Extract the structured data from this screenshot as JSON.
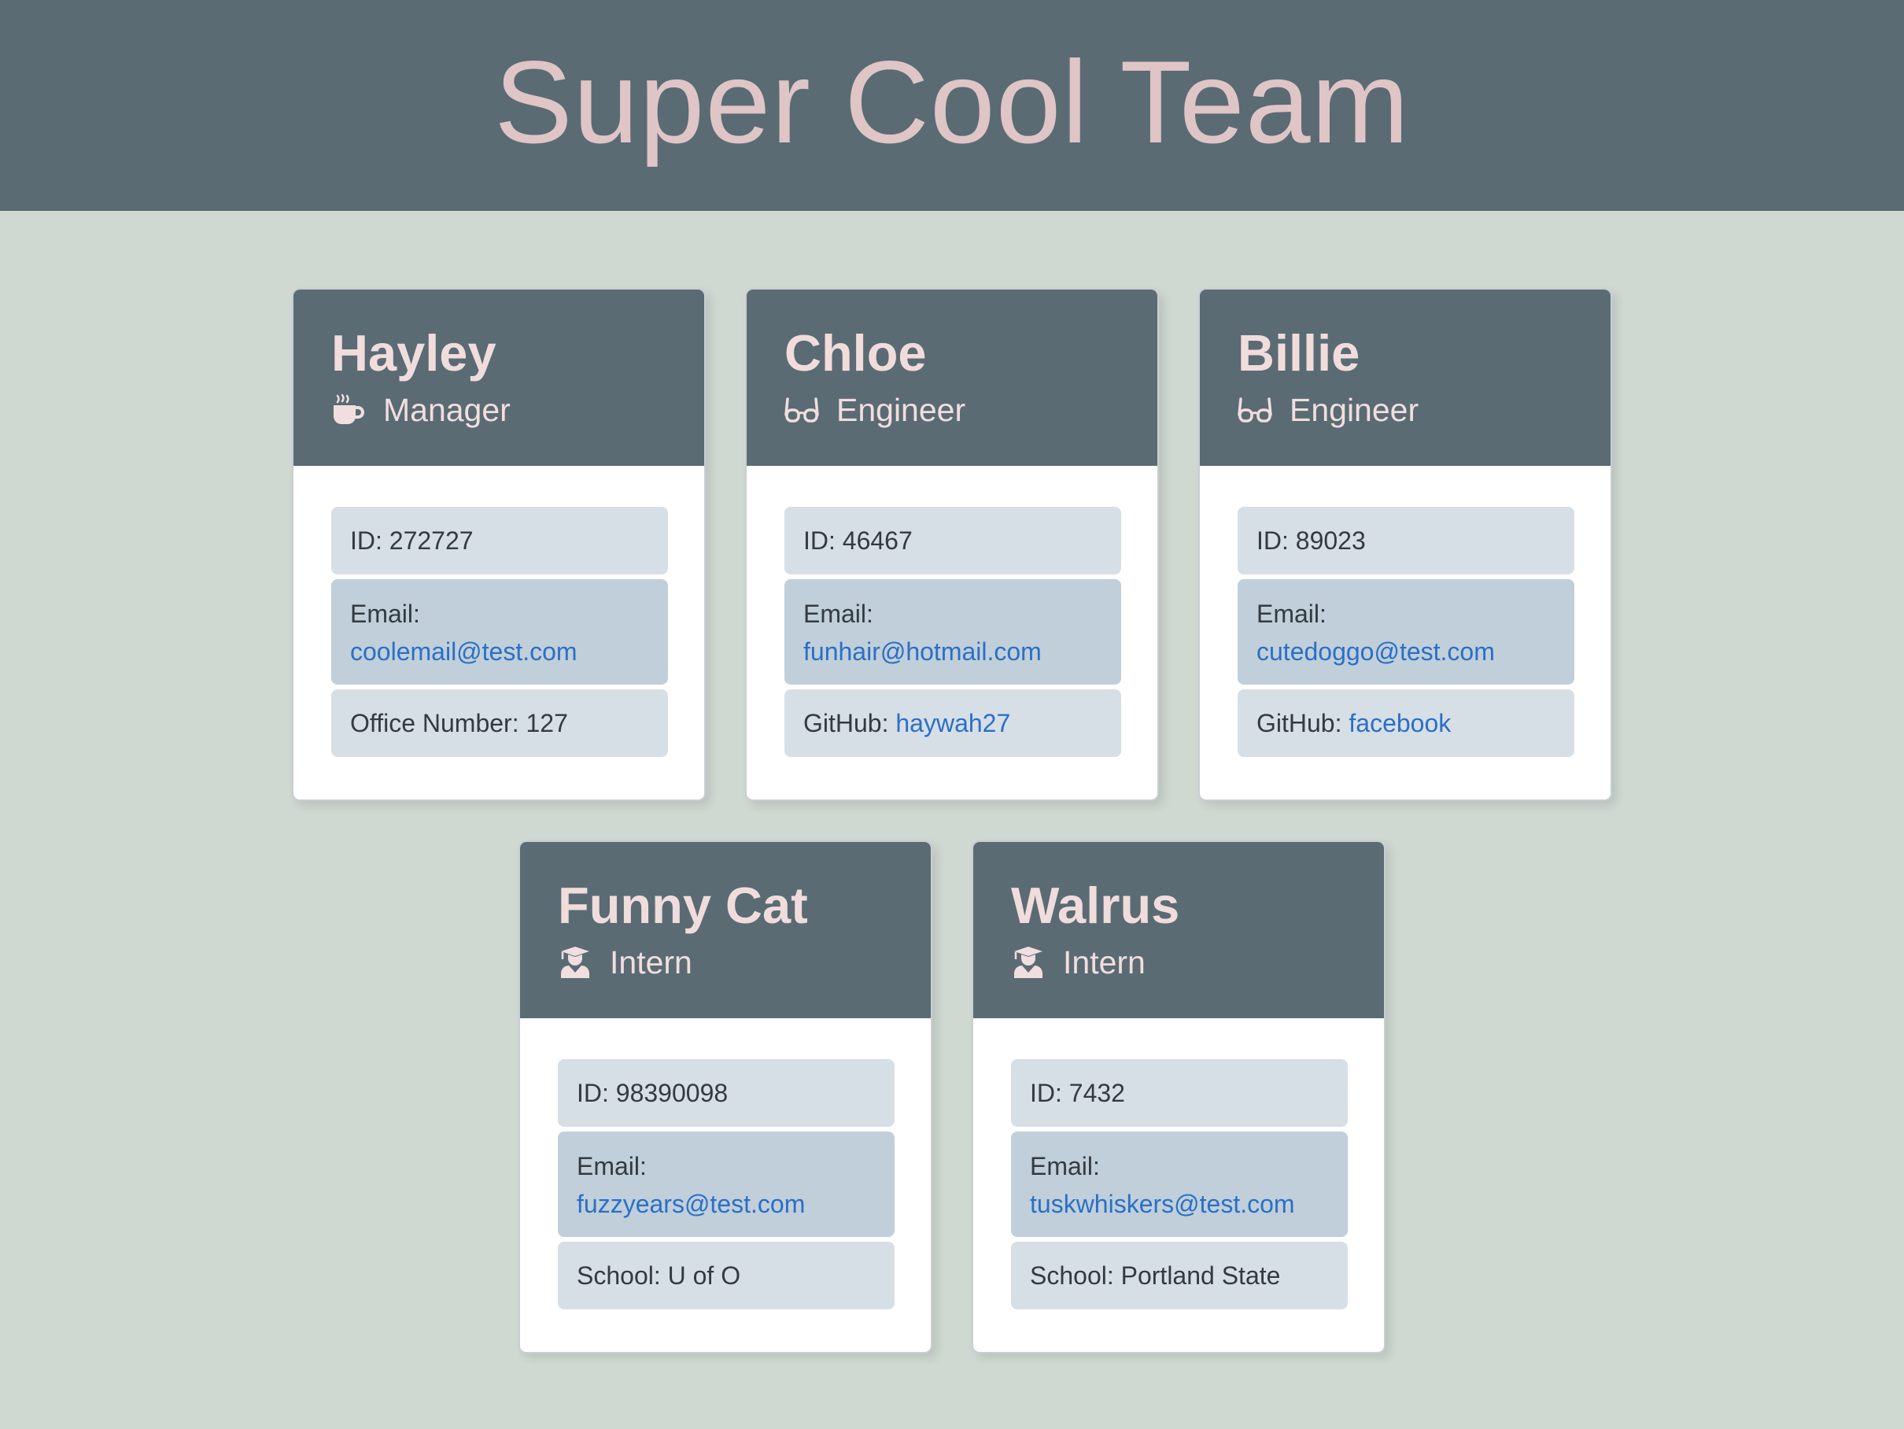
{
  "page": {
    "title": "Super Cool Team"
  },
  "colors": {
    "header_bg": "#5a6b74",
    "page_bg": "#d0d8d2",
    "title_color": "#dfc5c6",
    "item_bg": "#d7dfe6",
    "email_bg": "#c0cfd9",
    "link_color": "#2b6fc7"
  },
  "labels": {
    "id_prefix": "ID: ",
    "email_label": "Email:",
    "office_prefix": "Office Number: ",
    "github_prefix": "GitHub: ",
    "school_prefix": "School: "
  },
  "team": [
    {
      "name": "Hayley",
      "role": "Manager",
      "icon": "coffee-mug-icon",
      "id": "272727",
      "email": "coolemail@test.com",
      "office_number": "127"
    },
    {
      "name": "Chloe",
      "role": "Engineer",
      "icon": "glasses-icon",
      "id": "46467",
      "email": "funhair@hotmail.com",
      "github": "haywah27"
    },
    {
      "name": "Billie",
      "role": "Engineer",
      "icon": "glasses-icon",
      "id": "89023",
      "email": "cutedoggo@test.com",
      "github": "facebook"
    },
    {
      "name": "Funny Cat",
      "role": "Intern",
      "icon": "graduate-icon",
      "id": "98390098",
      "email": "fuzzyears@test.com",
      "school": "U of O"
    },
    {
      "name": "Walrus",
      "role": "Intern",
      "icon": "graduate-icon",
      "id": "7432",
      "email": "tuskwhiskers@test.com",
      "school": "Portland State"
    }
  ]
}
